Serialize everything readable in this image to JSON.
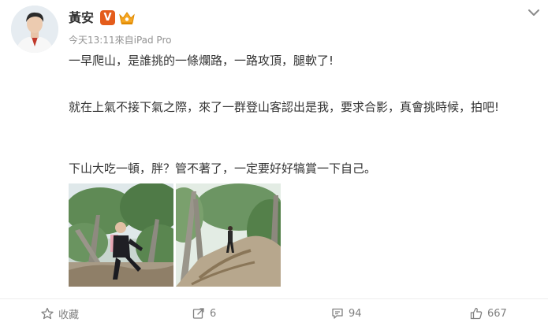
{
  "post": {
    "author": {
      "name": "黃安",
      "verified_badge": "V"
    },
    "meta": {
      "time": "今天13:11",
      "source_prefix": "來自",
      "source": "iPad Pro"
    },
    "paragraphs": [
      "一早爬山，是誰挑的一條爛路，一路攻頂，腿軟了!",
      "就在上氣不接下氣之際，來了一群登山客認出是我，要求合影，真會挑時候，拍吧!",
      "下山大吃一頓，胖？管不著了，一定要好好犒賞一下自己。"
    ],
    "images": [
      {
        "icon": "hiking-photo-man-posing"
      },
      {
        "icon": "hiking-photo-trail"
      }
    ]
  },
  "actions": {
    "favorite_label": "收藏",
    "repost_count": "6",
    "comment_count": "94",
    "like_count": "667"
  },
  "colors": {
    "text": "#333333",
    "meta": "#939393",
    "action": "#808080",
    "verified": "#e45c1b",
    "vip": "#f5a623",
    "divider": "#eeeeee"
  }
}
